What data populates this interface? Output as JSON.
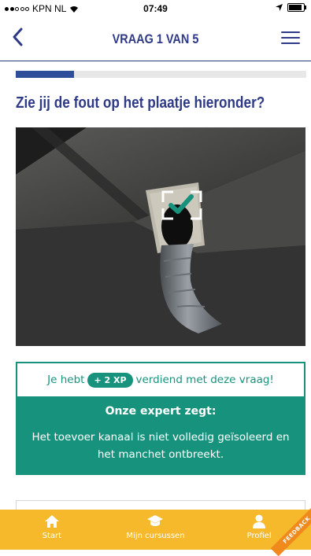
{
  "status_bar": {
    "carrier": "KPN NL",
    "time": "07:49"
  },
  "nav": {
    "title": "VRAAG 1 VAN 5"
  },
  "progress": {
    "current": 1,
    "total": 5,
    "fraction": 0.2
  },
  "question": {
    "text": "Zie jij de fout op het plaatje hieronder?"
  },
  "result": {
    "xp_prefix": "Je hebt",
    "xp_badge": "+ 2 XP",
    "xp_suffix": "verdiend met deze vraag!",
    "expert_title": "Onze expert zegt:",
    "expert_text": "Het toevoer kanaal is niet volledig geïsoleerd en het manchet ontbreekt."
  },
  "tabs": [
    {
      "label": "Start",
      "icon": "home-icon"
    },
    {
      "label": "Mijn cursussen",
      "icon": "graduation-cap-icon"
    },
    {
      "label": "Profiel",
      "icon": "person-icon"
    }
  ],
  "feedback_ribbon": "FEEDBACK",
  "colors": {
    "navy": "#2f3a86",
    "teal": "#17937d",
    "yellow": "#f6b92c",
    "orange": "#f08a1c"
  }
}
